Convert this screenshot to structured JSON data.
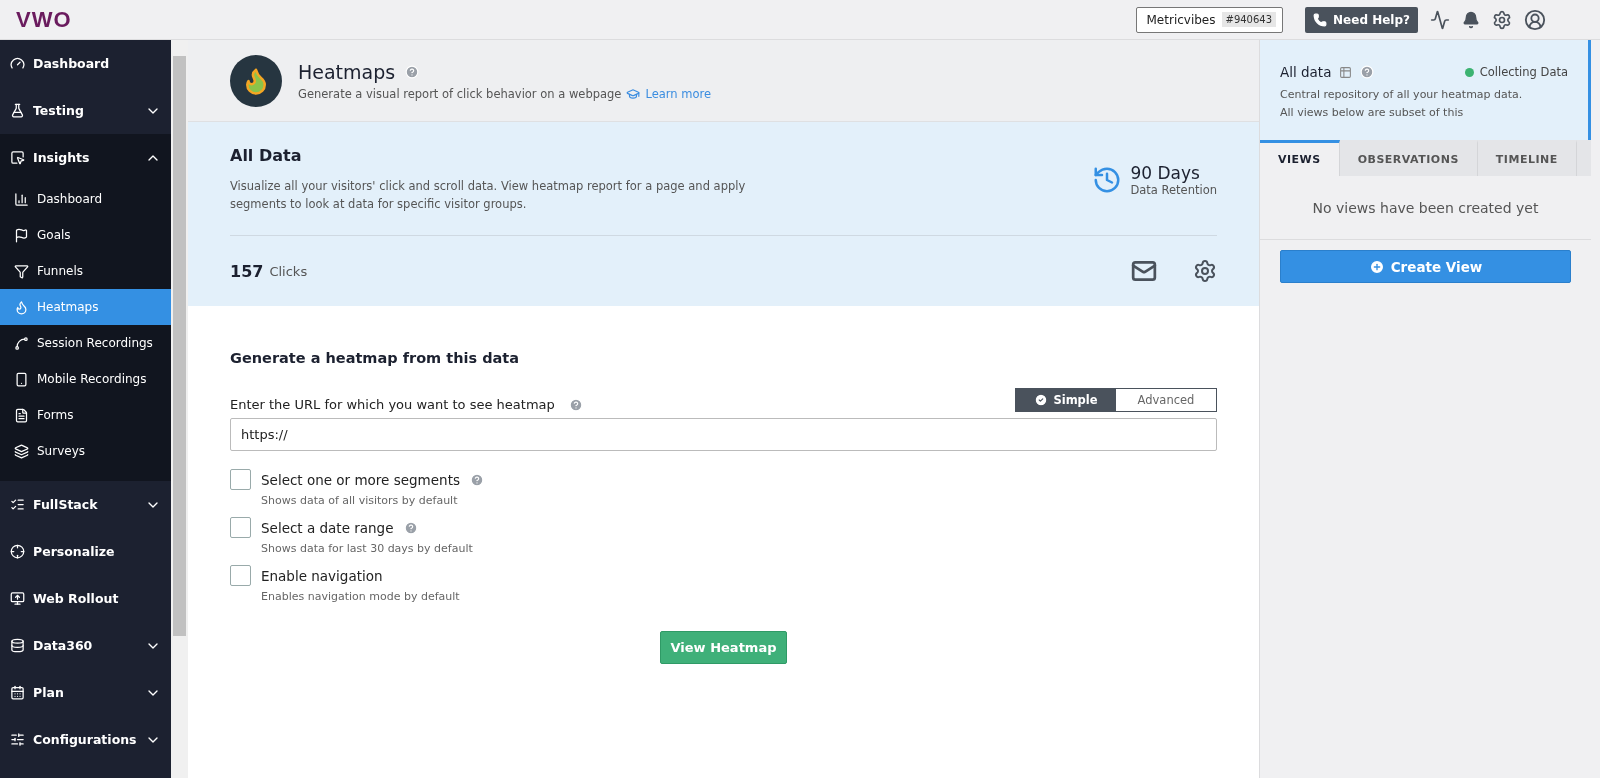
{
  "topbar": {
    "logo": "VWO",
    "account": {
      "name": "Metricvibes",
      "id": "#940643"
    },
    "help": "Need Help?"
  },
  "sidebar": {
    "items": [
      {
        "label": "Dashboard",
        "kind": "link",
        "selected": false
      },
      {
        "label": "Testing",
        "kind": "group",
        "expanded": false,
        "selected": false
      },
      {
        "label": "Insights",
        "kind": "group",
        "expanded": true,
        "selected": false,
        "children": [
          {
            "label": "Dashboard",
            "selected": false
          },
          {
            "label": "Goals",
            "selected": false
          },
          {
            "label": "Funnels",
            "selected": false
          },
          {
            "label": "Heatmaps",
            "selected": true
          },
          {
            "label": "Session Recordings",
            "selected": false
          },
          {
            "label": "Mobile Recordings",
            "selected": false
          },
          {
            "label": "Forms",
            "selected": false
          },
          {
            "label": "Surveys",
            "selected": false
          }
        ]
      },
      {
        "label": "FullStack",
        "kind": "group",
        "expanded": false,
        "selected": false
      },
      {
        "label": "Personalize",
        "kind": "link",
        "selected": false
      },
      {
        "label": "Web Rollout",
        "kind": "link",
        "selected": false
      },
      {
        "label": "Data360",
        "kind": "group",
        "expanded": false,
        "selected": false
      },
      {
        "label": "Plan",
        "kind": "group",
        "expanded": false,
        "selected": false
      },
      {
        "label": "Configurations",
        "kind": "group",
        "expanded": false,
        "selected": false
      }
    ]
  },
  "header": {
    "title": "Heatmaps",
    "subtitle": "Generate a visual report of click behavior on a webpage",
    "learn_more": "Learn more"
  },
  "summary": {
    "title": "All Data",
    "description": "Visualize all your visitors' click and scroll data. View heatmap report for a page and apply segments to look at data for specific visitor groups.",
    "retention_value": "90 Days",
    "retention_label": "Data Retention",
    "clicks_count": "157",
    "clicks_label": "Clicks"
  },
  "form": {
    "title": "Generate a heatmap from this data",
    "url_label": "Enter the URL for which you want to see heatmap",
    "modes": [
      {
        "label": "Simple",
        "selected": true
      },
      {
        "label": "Advanced",
        "selected": false
      }
    ],
    "url_value": "https://",
    "options": [
      {
        "label": "Select one or more segments",
        "hint": "Shows data of all visitors by default",
        "checked": false,
        "help": true
      },
      {
        "label": "Select a date range",
        "hint": "Shows data for last 30 days by default",
        "checked": false,
        "help": true
      },
      {
        "label": "Enable navigation",
        "hint": "Enables navigation mode by default",
        "checked": false,
        "help": false
      }
    ],
    "submit": "View Heatmap"
  },
  "panel": {
    "title": "All data",
    "status": "Collecting Data",
    "description": [
      "Central repository of all your heatmap data.",
      "All views below are subset of this"
    ],
    "tabs": [
      {
        "label": "VIEWS",
        "selected": true
      },
      {
        "label": "OBSERVATIONS",
        "selected": false
      },
      {
        "label": "TIMELINE",
        "selected": false
      }
    ],
    "empty": "No views have been created yet",
    "create": "Create View"
  }
}
